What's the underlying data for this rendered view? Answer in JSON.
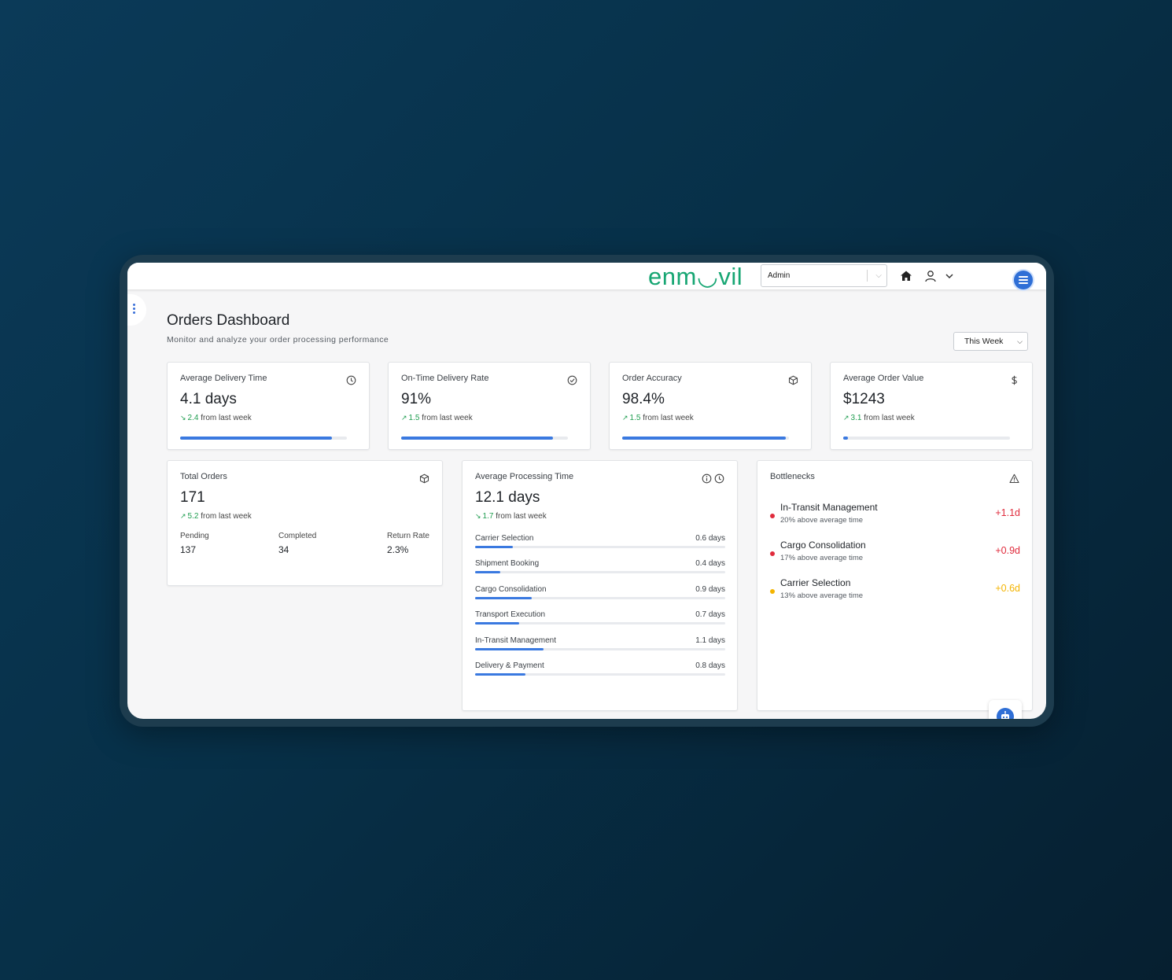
{
  "app": {
    "logo_text": "enm",
    "logo_face": "◡",
    "logo_tail": "vil",
    "role": "Admin"
  },
  "page": {
    "title": "Orders Dashboard",
    "subtitle": "Monitor and analyze your order processing performance",
    "period": "This Week"
  },
  "kpis": [
    {
      "title": "Average Delivery Time",
      "value": "4.1 days",
      "trend_arrow": "↘",
      "trend_value": "2.4",
      "trend_text": "from last week",
      "progress": 0.91,
      "icon": "clock-icon"
    },
    {
      "title": "On-Time Delivery Rate",
      "value": "91%",
      "trend_arrow": "↗",
      "trend_value": "1.5",
      "trend_text": "from last week",
      "progress": 0.91,
      "icon": "check-circle-icon"
    },
    {
      "title": "Order Accuracy",
      "value": "98.4%",
      "trend_arrow": "↗",
      "trend_value": "1.5",
      "trend_text": "from last week",
      "progress": 0.98,
      "icon": "box-icon"
    },
    {
      "title": "Average Order Value",
      "value": "$1243",
      "trend_arrow": "↗",
      "trend_value": "3.1",
      "trend_text": "from last week",
      "progress": 0.03,
      "icon": "dollar-icon"
    }
  ],
  "total_orders": {
    "title": "Total Orders",
    "value": "171",
    "trend_arrow": "↗",
    "trend_value": "5.2",
    "trend_text": "from last week",
    "stats": [
      {
        "label": "Pending",
        "value": "137"
      },
      {
        "label": "Completed",
        "value": "34"
      },
      {
        "label": "Return Rate",
        "value": "2.3%"
      }
    ]
  },
  "processing": {
    "title": "Average Processing Time",
    "value": "12.1 days",
    "trend_arrow": "↘",
    "trend_value": "1.7",
    "trend_text": "from last week",
    "steps": [
      {
        "label": "Carrier Selection",
        "value": "0.6 days",
        "fraction": 0.15
      },
      {
        "label": "Shipment Booking",
        "value": "0.4 days",
        "fraction": 0.1
      },
      {
        "label": "Cargo Consolidation",
        "value": "0.9 days",
        "fraction": 0.225
      },
      {
        "label": "Transport Execution",
        "value": "0.7 days",
        "fraction": 0.175
      },
      {
        "label": "In-Transit Management",
        "value": "1.1 days",
        "fraction": 0.275
      },
      {
        "label": "Delivery & Payment",
        "value": "0.8 days",
        "fraction": 0.2
      }
    ]
  },
  "bottlenecks": {
    "title": "Bottlenecks",
    "items": [
      {
        "name": "In-Transit Management",
        "desc": "20% above average time",
        "delta": "+1.1d",
        "color": "#e02b3c"
      },
      {
        "name": "Cargo Consolidation",
        "desc": "17% above average time",
        "delta": "+0.9d",
        "color": "#e02b3c"
      },
      {
        "name": "Carrier Selection",
        "desc": "13% above average time",
        "delta": "+0.6d",
        "color": "#f4b400"
      }
    ]
  },
  "colors": {
    "accent": "#3a79e0",
    "positive": "#1e9d4f",
    "brand": "#17a673"
  }
}
